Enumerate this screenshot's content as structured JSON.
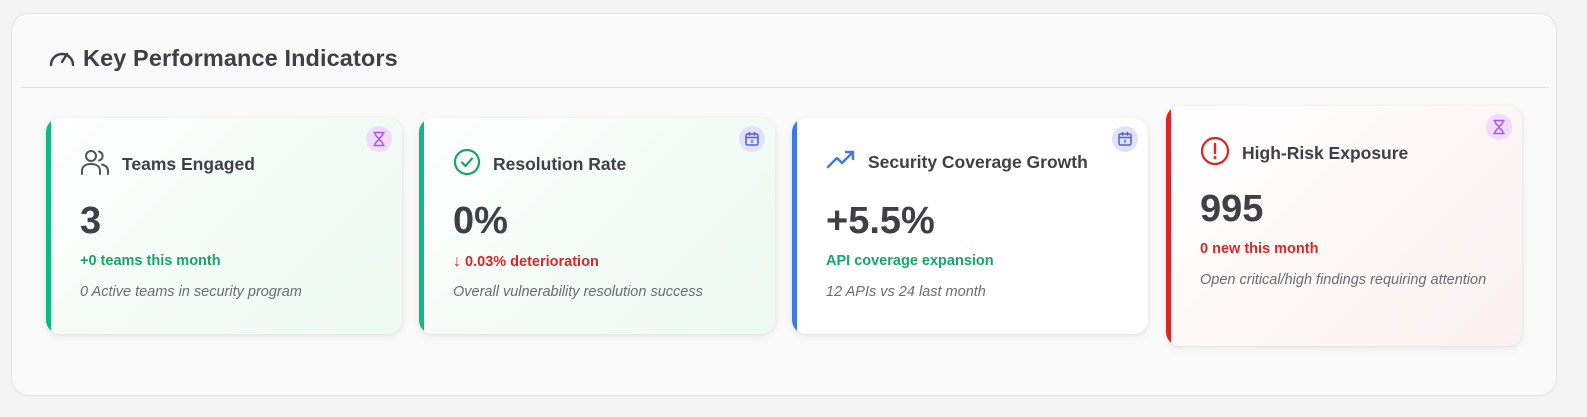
{
  "panel": {
    "title": "Key Performance Indicators",
    "title_icon": "gauge-icon"
  },
  "cards": [
    {
      "title": "Teams Engaged",
      "icon": "users-icon",
      "badge_icon": "hourglass-icon",
      "value": "3",
      "delta": "+0 teams this month",
      "description": "0 Active teams in security program",
      "accent": "#10b981"
    },
    {
      "title": "Resolution Rate",
      "icon": "check-circle-icon",
      "badge_icon": "calendar-icon",
      "value": "0%",
      "delta_arrow": "↓",
      "delta": "0.03% deterioration",
      "description": "Overall vulnerability resolution success",
      "accent": "#10b981"
    },
    {
      "title": "Security Coverage Growth",
      "icon": "trending-up-icon",
      "badge_icon": "calendar-icon",
      "value": "+5.5%",
      "delta": "API coverage expansion",
      "description": "12 APIs vs 24 last month",
      "accent": "#3b7ae6"
    },
    {
      "title": "High-Risk Exposure",
      "icon": "alert-circle-icon",
      "badge_icon": "hourglass-icon",
      "value": "995",
      "delta": "0 new this month",
      "description": "Open critical/high findings requiring attention",
      "accent": "#dc2626"
    }
  ],
  "colors": {
    "green": "#16a56a",
    "red": "#d92626",
    "blue": "#3b7ae6",
    "purple": "#a855f7",
    "indigo": "#5b5fc7",
    "text": "#3f3f46",
    "muted": "#6b6b72"
  }
}
